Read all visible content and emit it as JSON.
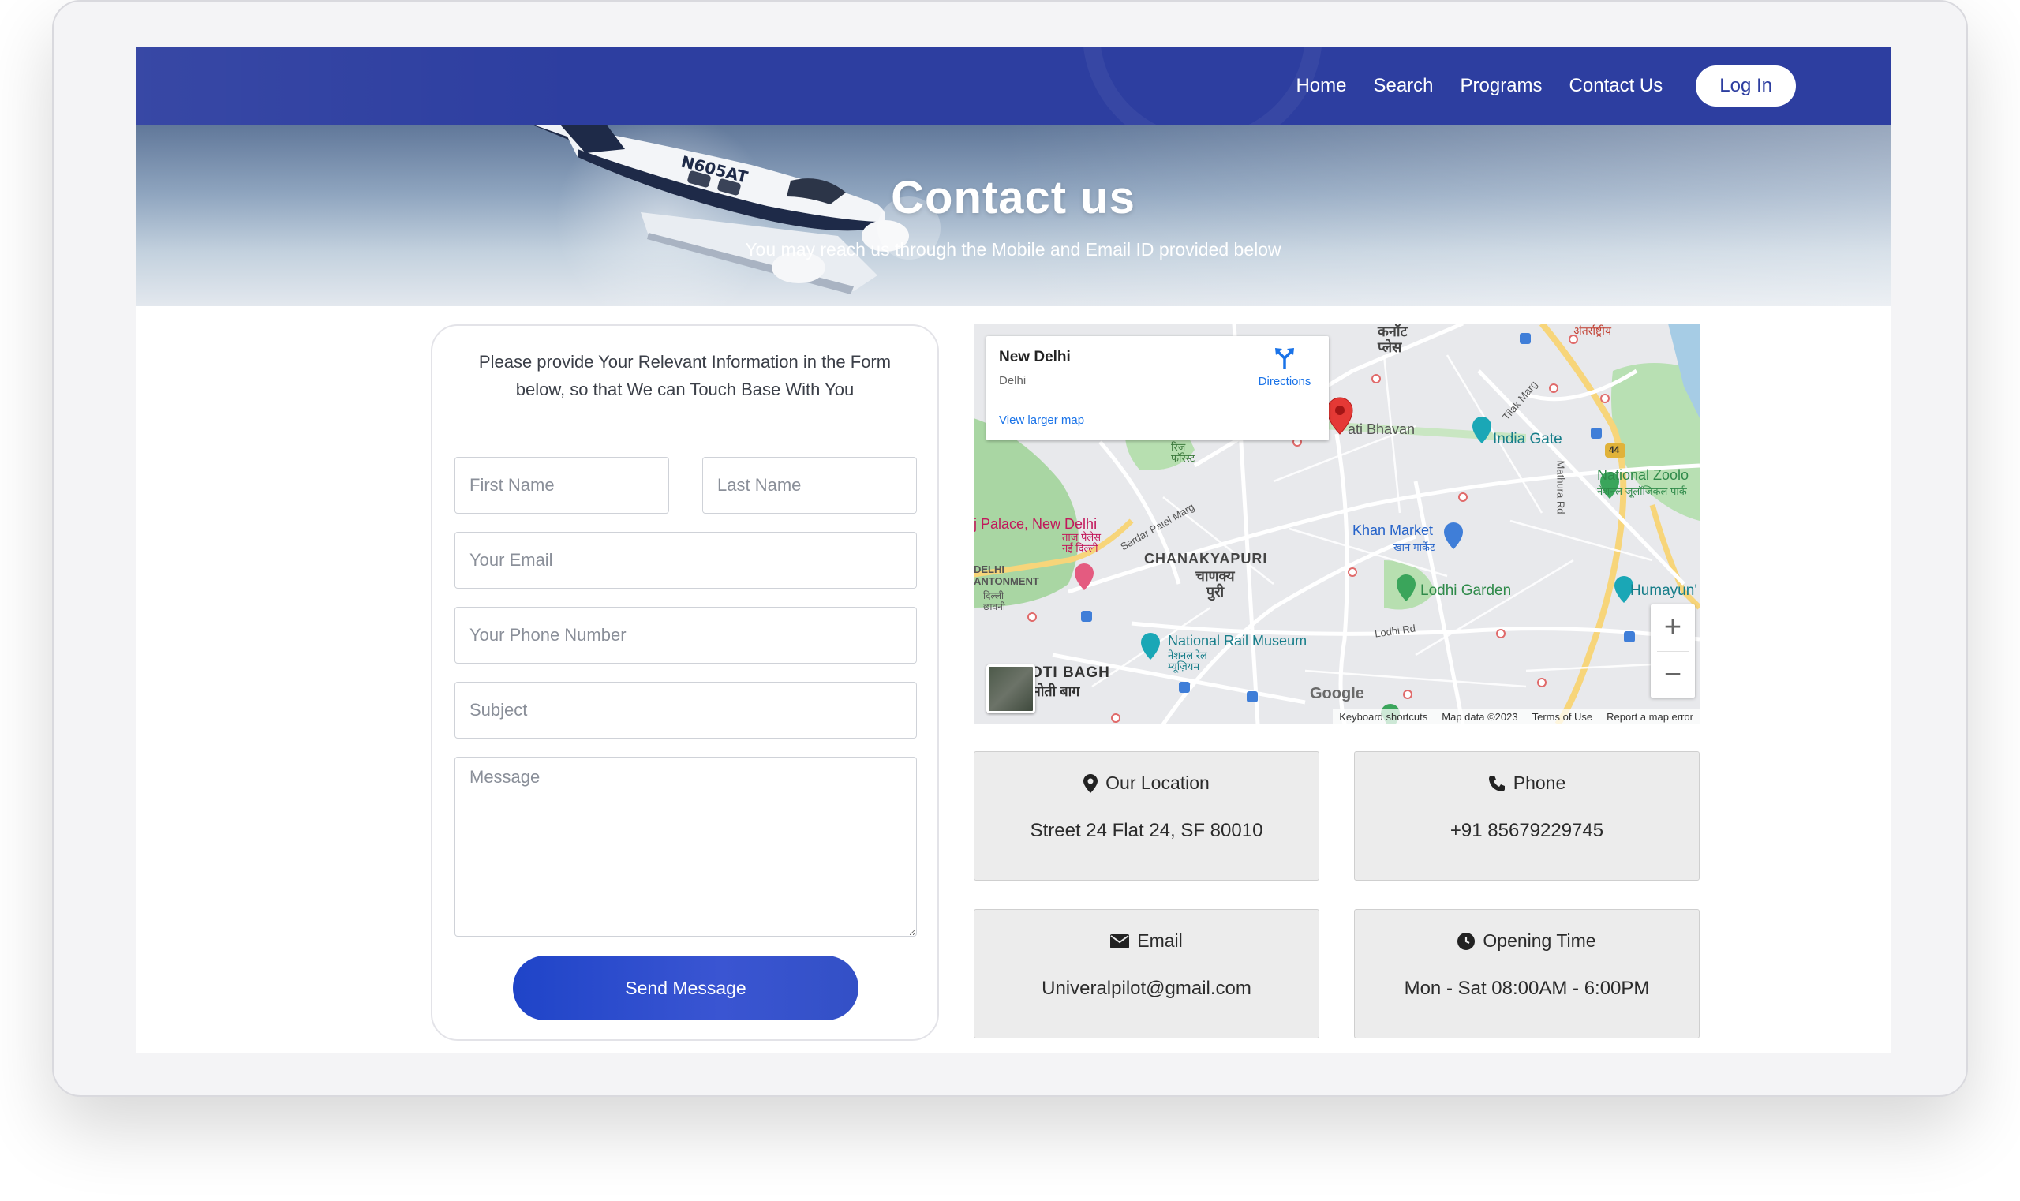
{
  "nav": {
    "items": [
      "Home",
      "Search",
      "Programs",
      "Contact Us"
    ],
    "login_label": "Log In"
  },
  "hero": {
    "title": "Contact us",
    "subtitle": "You may reach us through the Mobile and Email ID provided below"
  },
  "form": {
    "intro": "Please provide Your Relevant Information in the Form below, so that We can Touch Base With You",
    "first_name_placeholder": "First Name",
    "last_name_placeholder": "Last Name",
    "email_placeholder": "Your Email",
    "phone_placeholder": "Your Phone Number",
    "subject_placeholder": "Subject",
    "message_placeholder": "Message",
    "submit_label": "Send Message"
  },
  "map": {
    "place_title": "New Delhi",
    "place_sub": "Delhi",
    "directions_label": "Directions",
    "larger_map_label": "View larger map",
    "labels": {
      "connaught": "कनॉट प्लेस",
      "antarrashtriya": "अंतर्राष्ट्रीय",
      "bhavan": "ati Bhavan",
      "india_gate": "India Gate",
      "national_zoo": "National Zoolo",
      "national_zoo_hi": "नेशनल जूलॉजिकल पार्क",
      "palace": "j Palace, New Delhi",
      "palace_hi": "ताज पैलेस नई दिल्ली",
      "chanakyapuri": "CHANAKYAPURI",
      "chanakyapuri_hi": "चाणक्य पुरी",
      "khan_market": "Khan Market",
      "khan_market_hi": "खान मार्केट",
      "lodhi_garden": "Lodhi Garden",
      "humayun": "Humayun'",
      "rail_museum": "National Rail Museum",
      "rail_museum_hi": "नेशनल रेल म्यूज़ियम",
      "cantonment": "DELHI ANTONMENT",
      "cantonment_hi": "दिल्ली छावनी",
      "moti_bagh": "OTI BAGH",
      "moti_bagh_hi": "मोती बाग",
      "lodhi_rd": "Lodhi Rd",
      "sardar_patel": "Sardar Patel Marg",
      "tilak_marg": "Tilak Marg",
      "mathura_rd": "Mathura Rd",
      "ridge": "रिज फॉरेस्ट",
      "route_44": "44"
    },
    "google_logo": "Google",
    "footer": [
      "Keyboard shortcuts",
      "Map data ©2023",
      "Terms of Use",
      "Report a map error"
    ],
    "zoom_in": "+",
    "zoom_out": "−"
  },
  "info": {
    "location": {
      "title": "Our Location",
      "value": "Street 24 Flat 24, SF 80010",
      "icon": "map-pin-icon"
    },
    "phone": {
      "title": "Phone",
      "value": "+91 85679229745",
      "icon": "phone-icon"
    },
    "email": {
      "title": "Email",
      "value": "Univeralpilot@gmail.com",
      "icon": "envelope-icon"
    },
    "hours": {
      "title": "Opening Time",
      "value": "Mon - Sat 08:00AM - 6:00PM",
      "icon": "clock-icon"
    }
  },
  "colors": {
    "nav_bg": "#2d3ea0",
    "button_blue": "#2d48c8",
    "card_bg": "#ececec",
    "map_pin": "#e53935"
  }
}
